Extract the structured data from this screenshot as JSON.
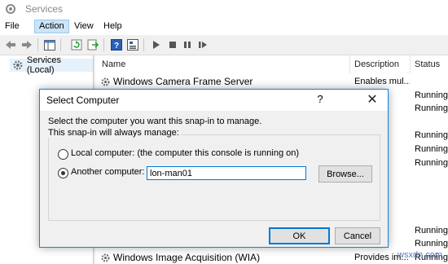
{
  "window": {
    "title": "Services"
  },
  "menu": {
    "file": "File",
    "action": "Action",
    "view": "View",
    "help": "Help"
  },
  "tree": {
    "root_label": "Services (Local)"
  },
  "columns": {
    "name": "Name",
    "description": "Description",
    "status": "Status"
  },
  "services": [
    {
      "name": "Windows Camera Frame Server",
      "description": "Enables mul...",
      "status": ""
    },
    {
      "name": "",
      "description": "C ...",
      "status": "Running"
    },
    {
      "name": "",
      "description": "...",
      "status": "Running"
    },
    {
      "name": "",
      "description": "",
      "status": ""
    },
    {
      "name": "",
      "description": "ard...",
      "status": "Running"
    },
    {
      "name": "",
      "description": "...",
      "status": "Running"
    },
    {
      "name": "",
      "description": "...",
      "status": "Running"
    },
    {
      "name": "",
      "description": "E...",
      "status": ""
    },
    {
      "name": "",
      "description": "...",
      "status": ""
    },
    {
      "name": "",
      "description": "ce ...",
      "status": ""
    },
    {
      "name": "",
      "description": "s...",
      "status": ""
    },
    {
      "name": "",
      "description": "fi...",
      "status": "Running"
    },
    {
      "name": "",
      "description": "s ...",
      "status": "Running"
    },
    {
      "name": "Windows Image Acquisition (WIA)",
      "description": "Provides im...",
      "status": "Running"
    }
  ],
  "dialog": {
    "title": "Select Computer",
    "help_glyph": "?",
    "close_glyph": "✕",
    "instruction": "Select the computer you want this snap-in to manage.",
    "group_label": "This snap-in will always manage:",
    "local_option": "Local computer:  (the computer this console is running on)",
    "another_option": "Another computer:",
    "computer_name": "lon-man01",
    "browse": "Browse...",
    "ok": "OK",
    "cancel": "Cancel",
    "selected": "another"
  },
  "watermark": "wsxdn.com"
}
